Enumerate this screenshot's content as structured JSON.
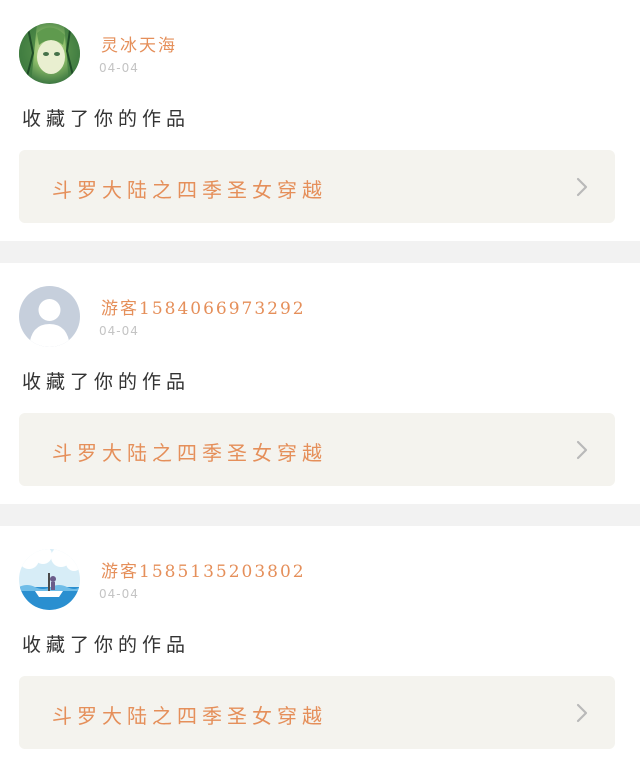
{
  "feed": {
    "items": [
      {
        "username": "灵冰天海",
        "date": "04-04",
        "action": "收藏了你的作品",
        "work_title": "斗罗大陆之四季圣女穿越",
        "avatar_icon": "anime-girl-avatar-icon"
      },
      {
        "username": "游客1584066973292",
        "date": "04-04",
        "action": "收藏了你的作品",
        "work_title": "斗罗大陆之四季圣女穿越",
        "avatar_icon": "default-user-avatar-icon"
      },
      {
        "username": "游客1585135203802",
        "date": "04-04",
        "action": "收藏了你的作品",
        "work_title": "斗罗大陆之四季圣女穿越",
        "avatar_icon": "ocean-boat-avatar-icon"
      }
    ]
  },
  "colors": {
    "accent": "#e58f5a",
    "date_text": "#c4c4c4",
    "work_box_bg": "#f4f3ee",
    "divider_bg": "#f2f2f2"
  }
}
